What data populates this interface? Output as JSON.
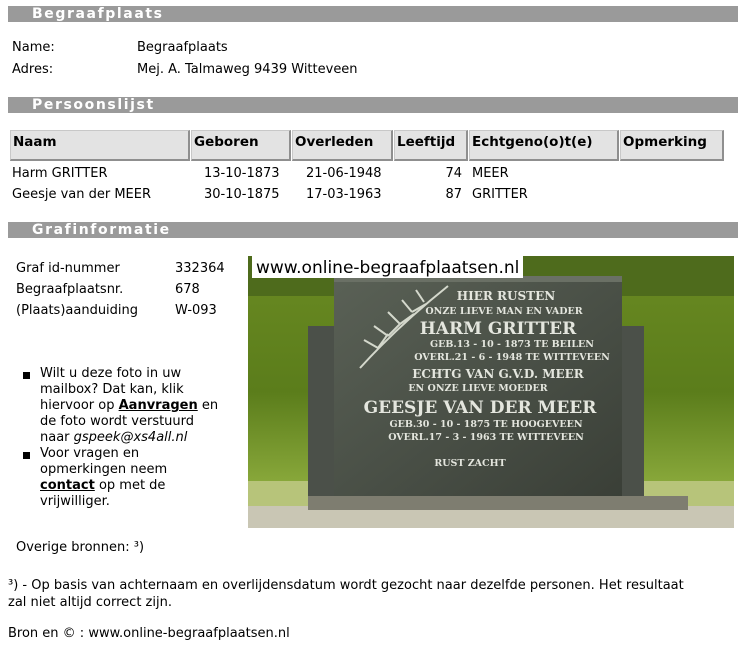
{
  "sections": {
    "begraafplaats": "Begraafplaats",
    "persoonslijst": "Persoonslijst",
    "grafinformatie": "Grafinformatie"
  },
  "info": {
    "name_label": "Name:",
    "name_value": "Begraafplaats",
    "address_label": "Adres:",
    "address_value": "Mej. A. Talmaweg 9439 Witteveen"
  },
  "table": {
    "headers": [
      "Naam",
      "Geboren",
      "Overleden",
      "Leeftijd",
      "Echtgeno(o)t(e)",
      "Opmerking"
    ],
    "rows": [
      [
        "Harm GRITTER",
        "13-10-1873",
        "21-06-1948",
        "74",
        "MEER",
        ""
      ],
      [
        "Geesje van der MEER",
        "30-10-1875",
        "17-03-1963",
        "87",
        "GRITTER",
        ""
      ]
    ]
  },
  "grave": {
    "graf_id_label": "Graf id-nummer",
    "graf_id_value": "332364",
    "nr_label": "Begraafplaatsnr.",
    "nr_value": "678",
    "aanduiding_label": "(Plaats)aanduiding",
    "aanduiding_value": "W-093"
  },
  "photo": {
    "caption": "www.online-begraafplaatsen.nl",
    "inscription": [
      "HIER RUSTEN",
      "ONZE LIEVE MAN EN VADER",
      "HARM GRITTER",
      "GEB.13 - 10 - 1873 TE BEILEN",
      "OVERL.21 - 6 - 1948 TE WITTEVEEN",
      "ECHTG VAN G.V.D. MEER",
      "EN ONZE LIEVE MOEDER",
      "GEESJE VAN DER MEER",
      "GEB.30 - 10 - 1875 TE HOOGEVEEN",
      "OVERL.17 - 3 - 1963 TE WITTEVEEN",
      "RUST ZACHT"
    ]
  },
  "bullets": {
    "b1_pre": "Wilt u deze foto in uw",
    "b1_l2": "mailbox? Dat kan, klik",
    "b1_l3_pre": "hiervoor op ",
    "b1_link": "Aanvragen",
    "b1_l3_post": " en",
    "b1_l4": "de foto wordt verstuurd",
    "b1_l5_pre": "naar ",
    "b1_email": "gspeek@xs4all.nl",
    "b2_l1": "Voor vragen en",
    "b2_l2": "opmerkingen neem",
    "b2_link": "contact",
    "b2_l3_post": " op met de",
    "b2_l4": "vrijwilliger."
  },
  "overige": "Overige bronnen: ³)",
  "footnote_l1": "³) - Op basis van achternaam en overlijdensdatum wordt gezocht naar dezelfde personen. Het resultaat",
  "footnote_l2": "zal niet altijd correct zijn.",
  "bron": "Bron en © : www.online-begraafplaatsen.nl"
}
